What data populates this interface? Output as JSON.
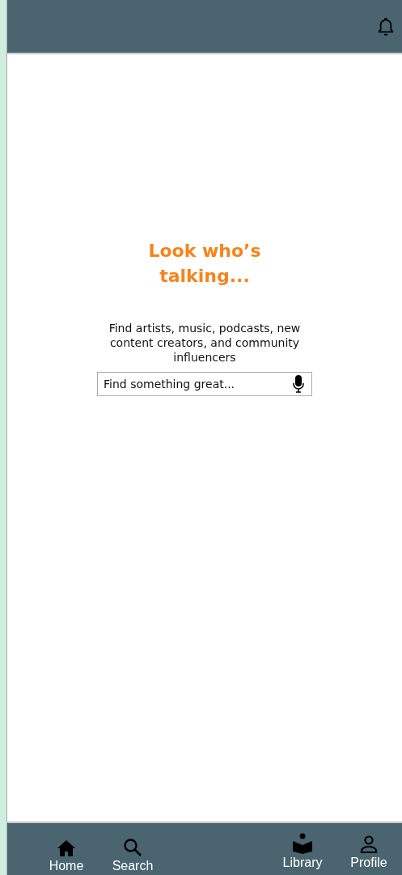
{
  "hero": {
    "title": "Look who’s talking...",
    "subtitle": "Find artists, music, podcasts, new content creators, and community influencers"
  },
  "search": {
    "placeholder": "Find something great..."
  },
  "bottom_nav": [
    {
      "kind": "home",
      "label": "Home"
    },
    {
      "kind": "search",
      "label": "Search"
    },
    {
      "kind": "library",
      "label": "Library"
    },
    {
      "kind": "profile",
      "label": "Profile"
    }
  ]
}
